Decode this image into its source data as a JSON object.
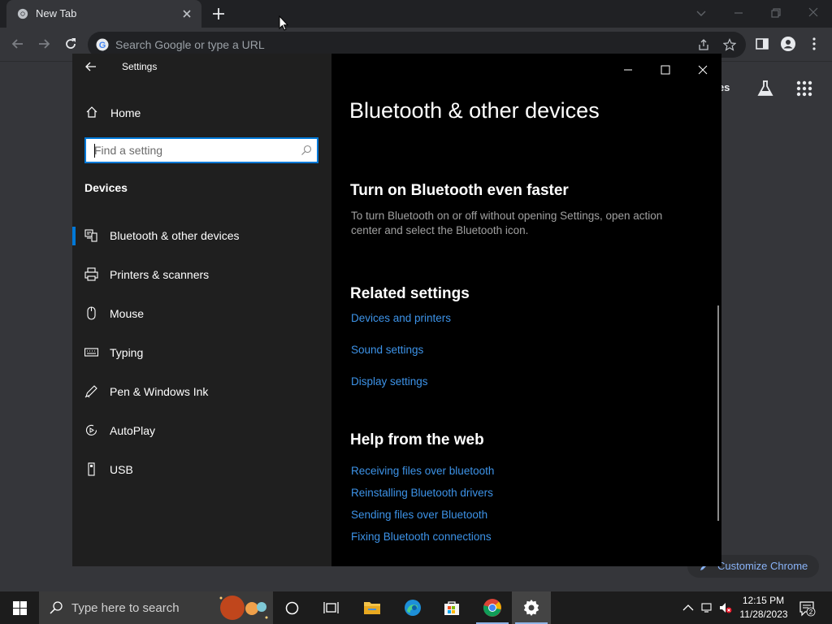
{
  "chrome": {
    "tab_title": "New Tab",
    "omnibox_placeholder": "Search Google or type a URL",
    "ntp_images_link": "ges",
    "customize_button": "Customize Chrome"
  },
  "settings": {
    "window_title": "Settings",
    "home_label": "Home",
    "search_placeholder": "Find a setting",
    "section_label": "Devices",
    "nav_items": [
      {
        "label": "Bluetooth & other devices",
        "icon": "bluetooth-devices-icon",
        "selected": true
      },
      {
        "label": "Printers & scanners",
        "icon": "printer-icon"
      },
      {
        "label": "Mouse",
        "icon": "mouse-icon"
      },
      {
        "label": "Typing",
        "icon": "keyboard-icon"
      },
      {
        "label": "Pen & Windows Ink",
        "icon": "pen-icon"
      },
      {
        "label": "AutoPlay",
        "icon": "autoplay-icon"
      },
      {
        "label": "USB",
        "icon": "usb-icon"
      }
    ],
    "main": {
      "title": "Bluetooth & other devices",
      "faster_heading": "Turn on Bluetooth even faster",
      "faster_text": "To turn Bluetooth on or off without opening Settings, open action center and select the Bluetooth icon.",
      "related_heading": "Related settings",
      "related_links": [
        "Devices and printers",
        "Sound settings",
        "Display settings"
      ],
      "help_heading": "Help from the web",
      "help_links": [
        "Receiving files over bluetooth",
        "Reinstalling Bluetooth drivers",
        "Sending files over Bluetooth",
        "Fixing Bluetooth connections"
      ]
    }
  },
  "taskbar": {
    "search_placeholder": "Type here to search",
    "clock_time": "12:15 PM",
    "clock_date": "11/28/2023",
    "notification_count": "2"
  },
  "colors": {
    "accent": "#0078d7",
    "link": "#3d93e8",
    "chrome_link": "#8ab4f8"
  }
}
